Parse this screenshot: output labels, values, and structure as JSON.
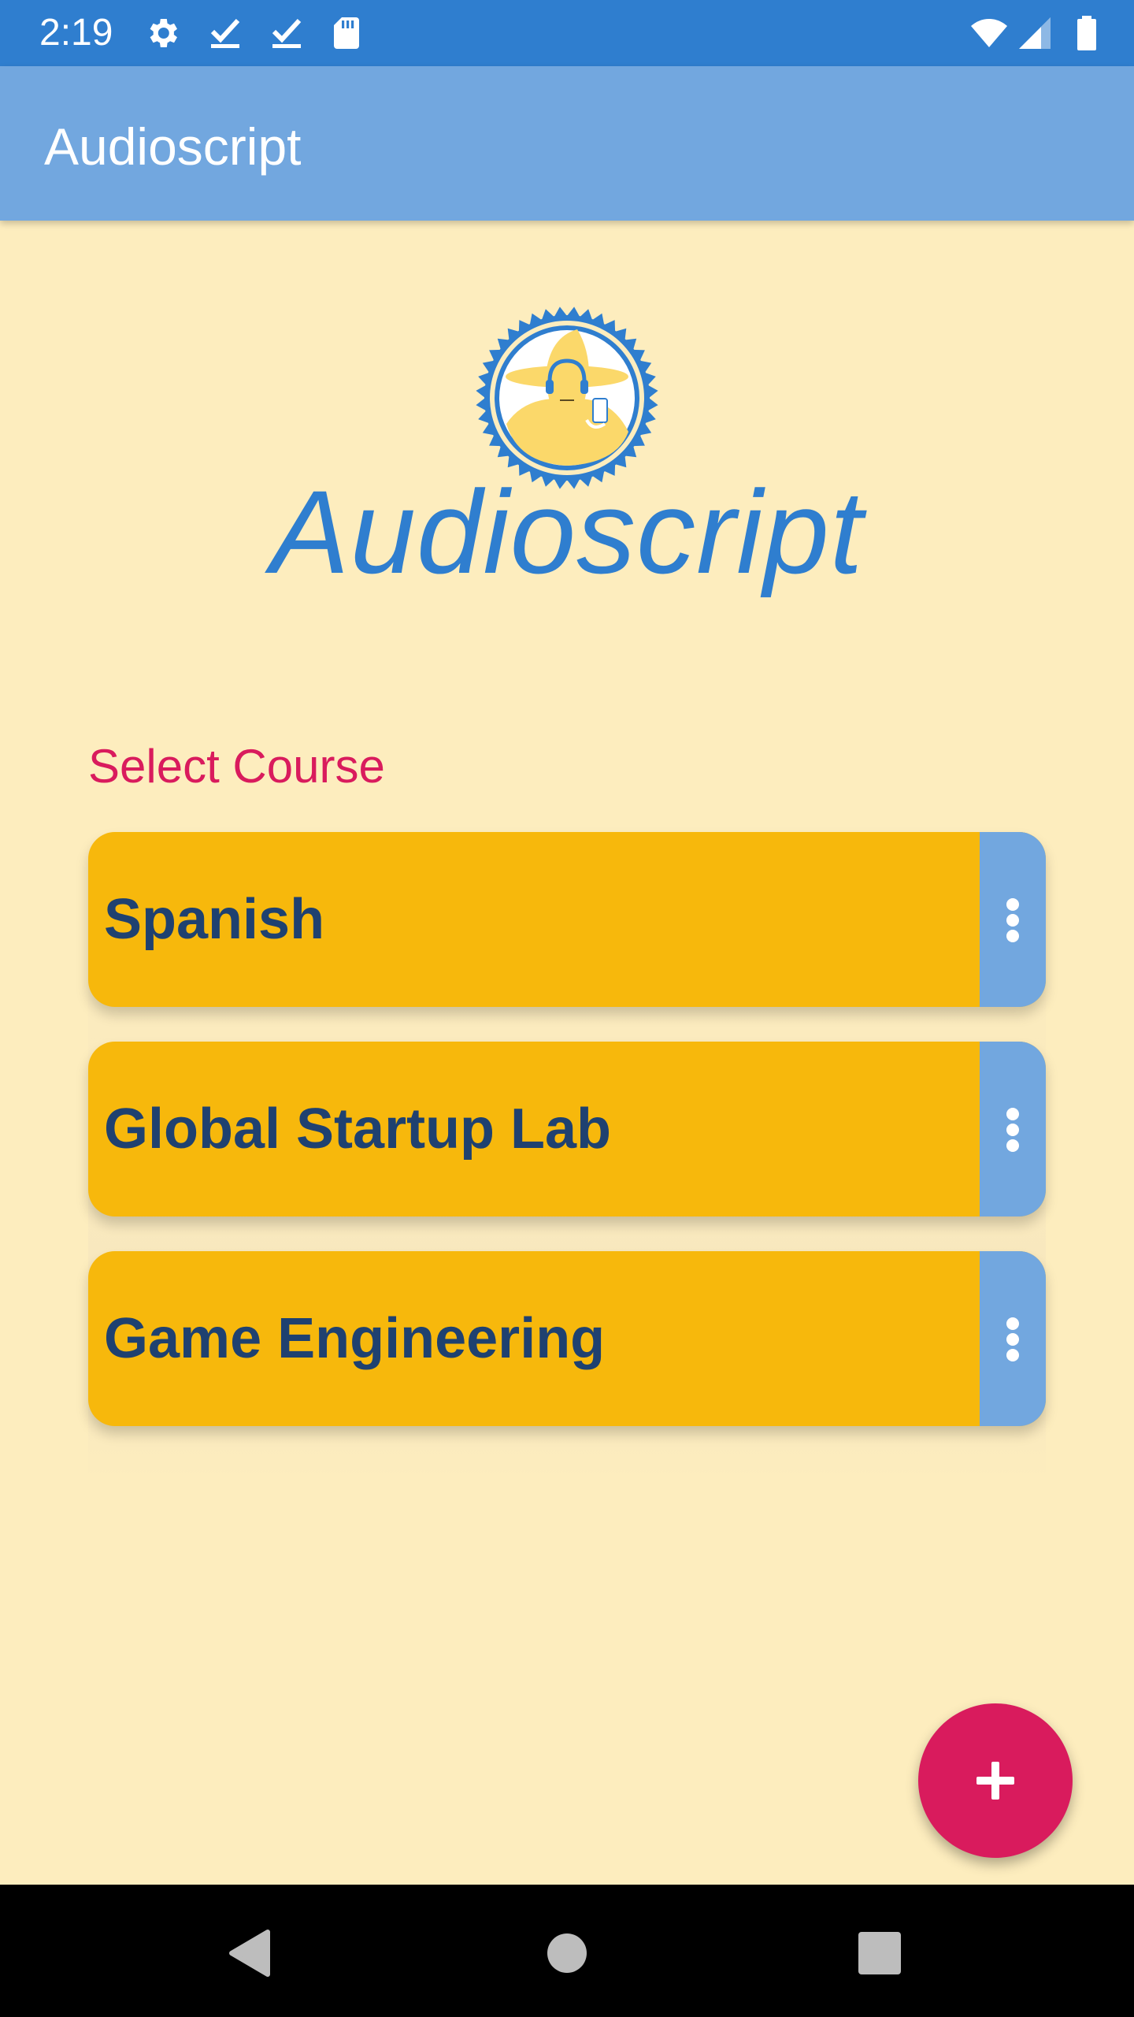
{
  "status_bar": {
    "time": "2:19",
    "left_icons": [
      "gear-icon",
      "check-icon",
      "check-icon",
      "sd-card-icon"
    ],
    "right_icons": [
      "wifi-icon",
      "signal-icon",
      "battery-icon"
    ]
  },
  "app_bar": {
    "title": "Audioscript"
  },
  "brand": {
    "name": "Audioscript"
  },
  "courses": {
    "label": "Select Course",
    "items": [
      {
        "name": "Spanish"
      },
      {
        "name": "Global Startup Lab"
      },
      {
        "name": "Game Engineering"
      }
    ]
  },
  "fab": {
    "icon": "plus-icon"
  },
  "nav": {
    "icons": [
      "back-icon",
      "home-icon",
      "recents-icon"
    ]
  },
  "colors": {
    "background": "#FDEDBE",
    "status_bar": "#2F7ECF",
    "app_bar": "#72A7DF",
    "card": "#F7B80C",
    "card_text": "#1F4170",
    "accent": "#D91B5D"
  }
}
